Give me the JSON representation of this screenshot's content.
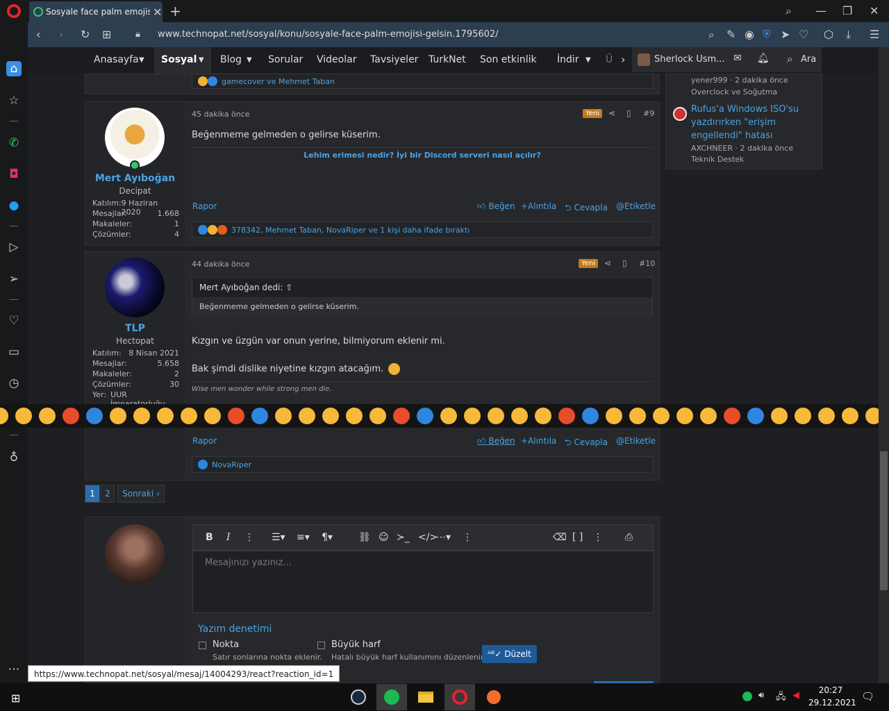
{
  "browser": {
    "tab_title": "Sosyale face palm emojisi g",
    "url": "www.technopat.net/sosyal/konu/sosyale-face-palm-emojisi-gelsin.1795602/",
    "status_url": "https://www.technopat.net/sosyal/mesaj/14004293/react?reaction_id=1"
  },
  "nav": {
    "items": [
      "Anasayfa",
      "Sosyal",
      "Blog",
      "Sorular",
      "Videolar",
      "Tavsiyeler",
      "TurkNet",
      "Son etkinlik",
      "İndir",
      "Ü"
    ],
    "user_label": "Sherlock Usm...",
    "search_label": "Ara"
  },
  "prev_post_reactions": "gamecover ve Mehmet Taban",
  "right_widget": {
    "item1_meta": "yener999 · 2 dakika önce",
    "item1_cat": "Overclock ve Soğutma",
    "item2_title_l1": "Rufus'a Windows ISO'su",
    "item2_title_l2": "yazdırırken \"erişim",
    "item2_title_l3": "engellendi\" hatası",
    "item2_meta": "AXCHNEER · 2 dakika önce",
    "item2_cat": "Teknik Destek"
  },
  "posts": [
    {
      "username": "Mert Ayıboğan",
      "usertitle": "Decipat",
      "stats": [
        {
          "k": "Katılım:",
          "v": "9 Haziran 2020"
        },
        {
          "k": "Mesajlar:",
          "v": "1.668"
        },
        {
          "k": "Makaleler:",
          "v": "1"
        },
        {
          "k": "Çözümler:",
          "v": "4"
        }
      ],
      "time": "45 dakika önce",
      "badge": "Yeni",
      "number": "#9",
      "text": "Beğenmeme gelmeden o gelirse küserim.",
      "related": "Lehim erimesi nedir? İyi bir Discord serveri nasıl açılır?",
      "report": "Rapor",
      "actions": [
        "Beğen",
        "+Alıntıla",
        "Cevapla",
        "Etiketle"
      ],
      "reactions": "378342, Mehmet Taban, NovaRiper ve 1 kişi daha ifade bıraktı"
    },
    {
      "username": "TLP",
      "usertitle": "Hectopat",
      "stats": [
        {
          "k": "Katılım:",
          "v": "8 Nisan 2021"
        },
        {
          "k": "Mesajlar:",
          "v": "5.658"
        },
        {
          "k": "Makaleler:",
          "v": "2"
        },
        {
          "k": "Çözümler:",
          "v": "30"
        }
      ],
      "location_k": "Yer:",
      "location_v": "UUR İmparatorluğu",
      "time": "44 dakika önce",
      "badge": "Yeni",
      "number": "#10",
      "quote_author": "Mert Ayıboğan dedi:",
      "quote_text": "Beğenmeme gelmeden o gelirse küserim.",
      "text1": "Kızgın ve üzgün var onun yerine, bilmiyorum eklenir mi.",
      "text2": "Bak şimdi dislike niyetine kızgın atacağım.",
      "signature": "Wise men wonder while strong men die.",
      "report": "Rapor",
      "actions": [
        "Beğen",
        "+Alıntıla",
        "Cevapla",
        "Etiketle"
      ],
      "reactions": "NovaRiper"
    }
  ],
  "pagination": {
    "p1": "1",
    "p2": "2",
    "next": "Sonraki ›"
  },
  "editor": {
    "placeholder": "Mesajınızı yazınız...",
    "spell_title": "Yazım denetimi",
    "opt1_label": "Nokta",
    "opt1_desc": "Satır sonlarına nokta eklenir.",
    "opt2_label": "Büyük harf",
    "opt2_desc": "Hatalı büyük harf kullanımını düzenlenir.",
    "fix_button": "Düzelt"
  },
  "taskbar": {
    "time": "20:27",
    "date": "29.12.2021"
  },
  "colors": {
    "accent": "#4ba3e3",
    "new_badge": "#c47a1a",
    "opera_red": "#e5222e"
  }
}
